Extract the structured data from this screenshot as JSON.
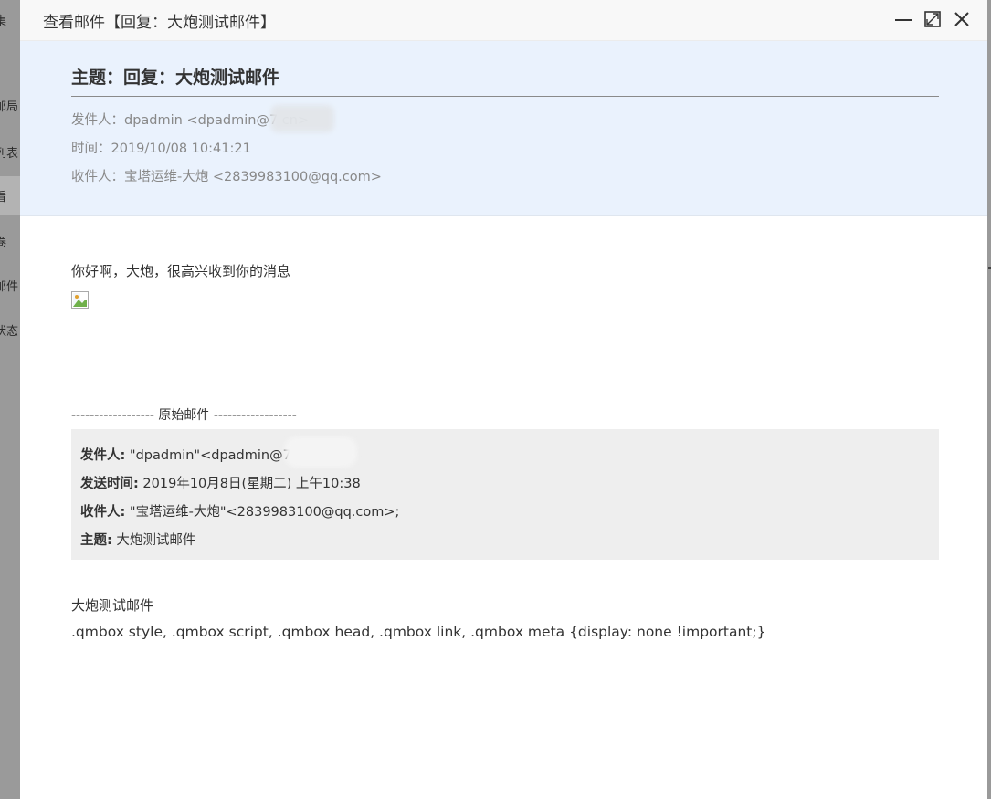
{
  "background": {
    "items": [
      "集",
      "邮局",
      "列表",
      "看",
      "卷",
      "邮件",
      "状态"
    ]
  },
  "dialog": {
    "title": "查看邮件【回复：大炮测试邮件】",
    "buttons": {
      "minimize": "minimize-icon",
      "maximize": "maximize-icon",
      "close": "close-icon"
    }
  },
  "header": {
    "subject": "主题：回复：大炮测试邮件",
    "from": "发件人：dpadmin <dpadmin@7          cn>",
    "time": "时间：2019/10/08 10:41:21",
    "to": "收件人：宝塔运维-大炮 <2839983100@qq.com>"
  },
  "body": {
    "greeting": "你好啊，大炮，很高兴收到你的消息",
    "original_divider": "------------------ 原始邮件 ------------------",
    "quote": {
      "from_label": "发件人:",
      "from_value": " \"dpadmin\"<dpadmin@7          n>;",
      "sent_label": "发送时间:",
      "sent_value": " 2019年10月8日(星期二) 上午10:38",
      "to_label": "收件人:",
      "to_value": " \"宝塔运维-大炮\"<2839983100@qq.com>;",
      "subject_label": "主题:",
      "subject_value": " 大炮测试邮件"
    },
    "original_body": "大炮测试邮件",
    "css_leak": ".qmbox style, .qmbox script, .qmbox head, .qmbox link, .qmbox meta {display: none !important;}"
  }
}
